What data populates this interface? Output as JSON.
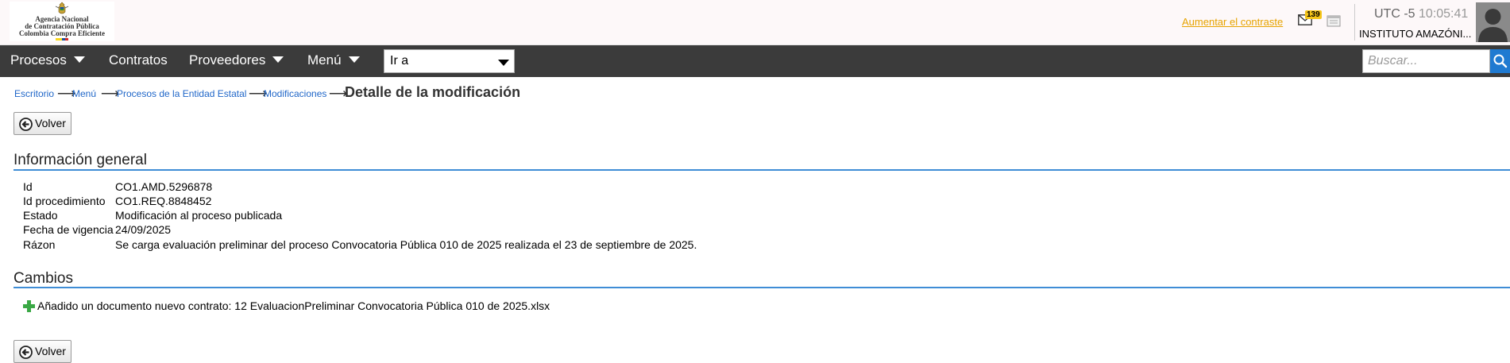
{
  "header": {
    "logo": {
      "line1": "Agencia Nacional",
      "line2": "de Contratación Pública",
      "line3": "Colombia Compra Eficiente"
    },
    "contrast_link": "Aumentar el contraste",
    "notification_count": "139",
    "timezone": "UTC -5",
    "time": "10:05:41",
    "organization": "INSTITUTO AMAZÓNI...",
    "icons": [
      "mail-icon",
      "document-icon",
      "user-avatar-icon"
    ]
  },
  "nav": {
    "items": [
      {
        "label": "Procesos",
        "dropdown": true
      },
      {
        "label": "Contratos",
        "dropdown": false
      },
      {
        "label": "Proveedores",
        "dropdown": true
      },
      {
        "label": "Menú",
        "dropdown": true
      }
    ],
    "goto_select": "Ir a",
    "search_placeholder": "Buscar...",
    "colors": {
      "bar": "#3b3b3b",
      "search_button": "#1f7ad1"
    }
  },
  "breadcrumb": {
    "items": [
      "Escritorio",
      "Menú",
      "Procesos de la Entidad Estatal",
      "Modificaciones"
    ],
    "separator": "⟶",
    "current": "Detalle de la modificación"
  },
  "buttons": {
    "back_label": "Volver"
  },
  "general_info": {
    "title": "Información general",
    "rows": [
      {
        "label": "Id",
        "value": "CO1.AMD.5296878"
      },
      {
        "label": "Id procedimiento",
        "value": "CO1.REQ.8848452"
      },
      {
        "label": "Estado",
        "value": "Modificación al proceso publicada"
      },
      {
        "label": "Fecha de vigencia",
        "value": "24/09/2025"
      },
      {
        "label": "Rázon",
        "value": "Se carga evaluación preliminar del proceso Convocatoria Pública 010 de 2025 realizada el 23 de septiembre de 2025."
      }
    ]
  },
  "changes": {
    "title": "Cambios",
    "items": [
      "Añadido un documento nuevo contrato: 12 EvaluacionPreliminar Convocatoria Pública 010 de 2025.xlsx"
    ]
  }
}
